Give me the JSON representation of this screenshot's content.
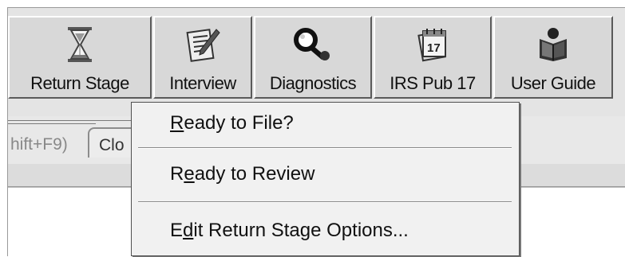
{
  "toolbar": {
    "buttons": [
      {
        "label": "Return Stage",
        "icon": "hourglass-icon"
      },
      {
        "label": "Interview",
        "icon": "notepad-pencil-icon"
      },
      {
        "label": "Diagnostics",
        "icon": "magnifier-icon"
      },
      {
        "label": "IRS Pub 17",
        "icon": "calendar-17-icon"
      },
      {
        "label": "User Guide",
        "icon": "reading-person-icon"
      }
    ]
  },
  "tabs": {
    "tab1_label": "hift+F9)",
    "tab2_label": "Clo"
  },
  "menu": {
    "items": [
      {
        "pre": "",
        "mnemonic": "R",
        "post": "eady to File?"
      },
      {
        "pre": "R",
        "mnemonic": "e",
        "post": "ady to Review"
      },
      {
        "pre": "E",
        "mnemonic": "d",
        "post": "it Return Stage Options..."
      }
    ]
  }
}
